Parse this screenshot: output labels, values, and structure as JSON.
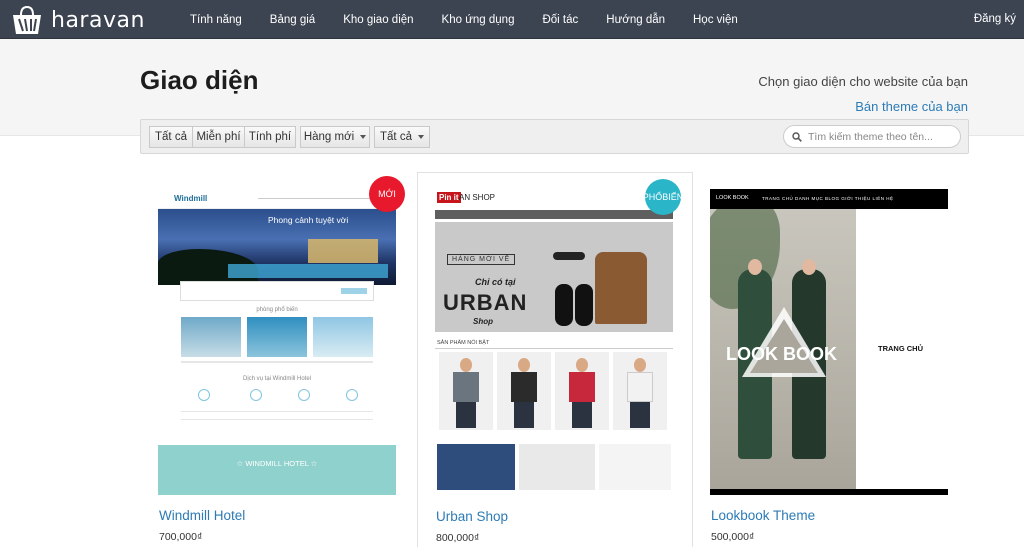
{
  "nav": {
    "logo_text": "haravan",
    "links": [
      "Tính năng",
      "Bảng giá",
      "Kho giao diện",
      "Kho ứng dụng",
      "Đối tác",
      "Hướng dẫn",
      "Học viện"
    ],
    "register": "Đăng ký"
  },
  "header": {
    "title": "Giao diện",
    "subtitle": "Chọn giao diện cho website của bạn",
    "sell_link": "Bán theme của bạn"
  },
  "filters": {
    "all": "Tất cả",
    "free": "Miễn phí",
    "paid": "Tính phí",
    "sort_label": "Hàng mới",
    "category_label": "Tất cả",
    "search_placeholder": "Tìm kiếm theme theo tên..."
  },
  "themes": [
    {
      "name": "Windmill Hotel",
      "price": "700,000₫",
      "badge": "MỚI",
      "badge_color": "#e8192c",
      "preview": {
        "logo": "Windmill",
        "hero_text": "Phong cảnh tuyệt vời",
        "section1": "phòng phổ biến",
        "section2": "Dịch vụ tại Windmill Hotel",
        "banner": "☆ WINDMILL HOTEL ☆"
      }
    },
    {
      "name": "Urban Shop",
      "price": "800,000₫",
      "badge": "PHỔ BIẾN",
      "badge_color": "#2bb5c9",
      "preview": {
        "logo": "Pin it",
        "logo_suffix": "AN SHOP",
        "tag": "HÀNG MỚI VỀ",
        "line1": "Chỉ có tại",
        "big": "URBAN",
        "shop": "Shop",
        "section": "SẢN PHẨM NỔI BẬT"
      }
    },
    {
      "name": "Lookbook Theme",
      "price": "500,000₫",
      "badge": "",
      "badge_color": "",
      "preview": {
        "logo": "LOOK BOOK",
        "menu": "TRANG CHỦ   DANH MỤC   BLOG   GIỚI THIỆU   LIÊN HỆ",
        "hero": "LOOK BOOK",
        "side": "TRANG CHỦ"
      }
    }
  ],
  "colors": {
    "navbar": "#3d4451",
    "link": "#2c7bb6",
    "badge_new": "#e8192c",
    "badge_popular": "#2bb5c9"
  }
}
